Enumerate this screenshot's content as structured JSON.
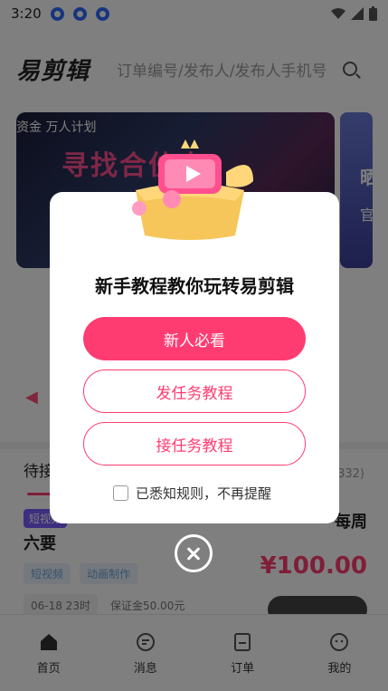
{
  "status_bar": {
    "time": "3:20"
  },
  "header": {
    "logo": "易剪辑",
    "search_placeholder": "订单编号/发布人/发布人手机号"
  },
  "banner": {
    "tag": "资金 万人计划",
    "headline": "寻找合伙人",
    "side_card_char1": "晒",
    "side_card_char2": "官"
  },
  "tabs": {
    "active": "待接",
    "count": "(3332)"
  },
  "task": {
    "badge": "短视频",
    "title_fragment": "六要",
    "title_right": "每周",
    "tags": [
      "短视频",
      "动画制作"
    ],
    "price": "¥100.00",
    "deadline": "06-18 23时",
    "deposit": "保证金50.00元"
  },
  "bottom_nav": [
    {
      "label": "首页",
      "icon": "home-icon"
    },
    {
      "label": "消息",
      "icon": "message-icon"
    },
    {
      "label": "订单",
      "icon": "order-icon"
    },
    {
      "label": "我的",
      "icon": "profile-icon"
    }
  ],
  "modal": {
    "title": "新手教程教你玩转易剪辑",
    "btn_new": "新人必看",
    "btn_send": "发任务教程",
    "btn_receive": "接任务教程",
    "checkbox_label": "已悉知规则，不再提醒"
  },
  "colors": {
    "accent": "#ff3c72",
    "primary_text": "#111111"
  }
}
